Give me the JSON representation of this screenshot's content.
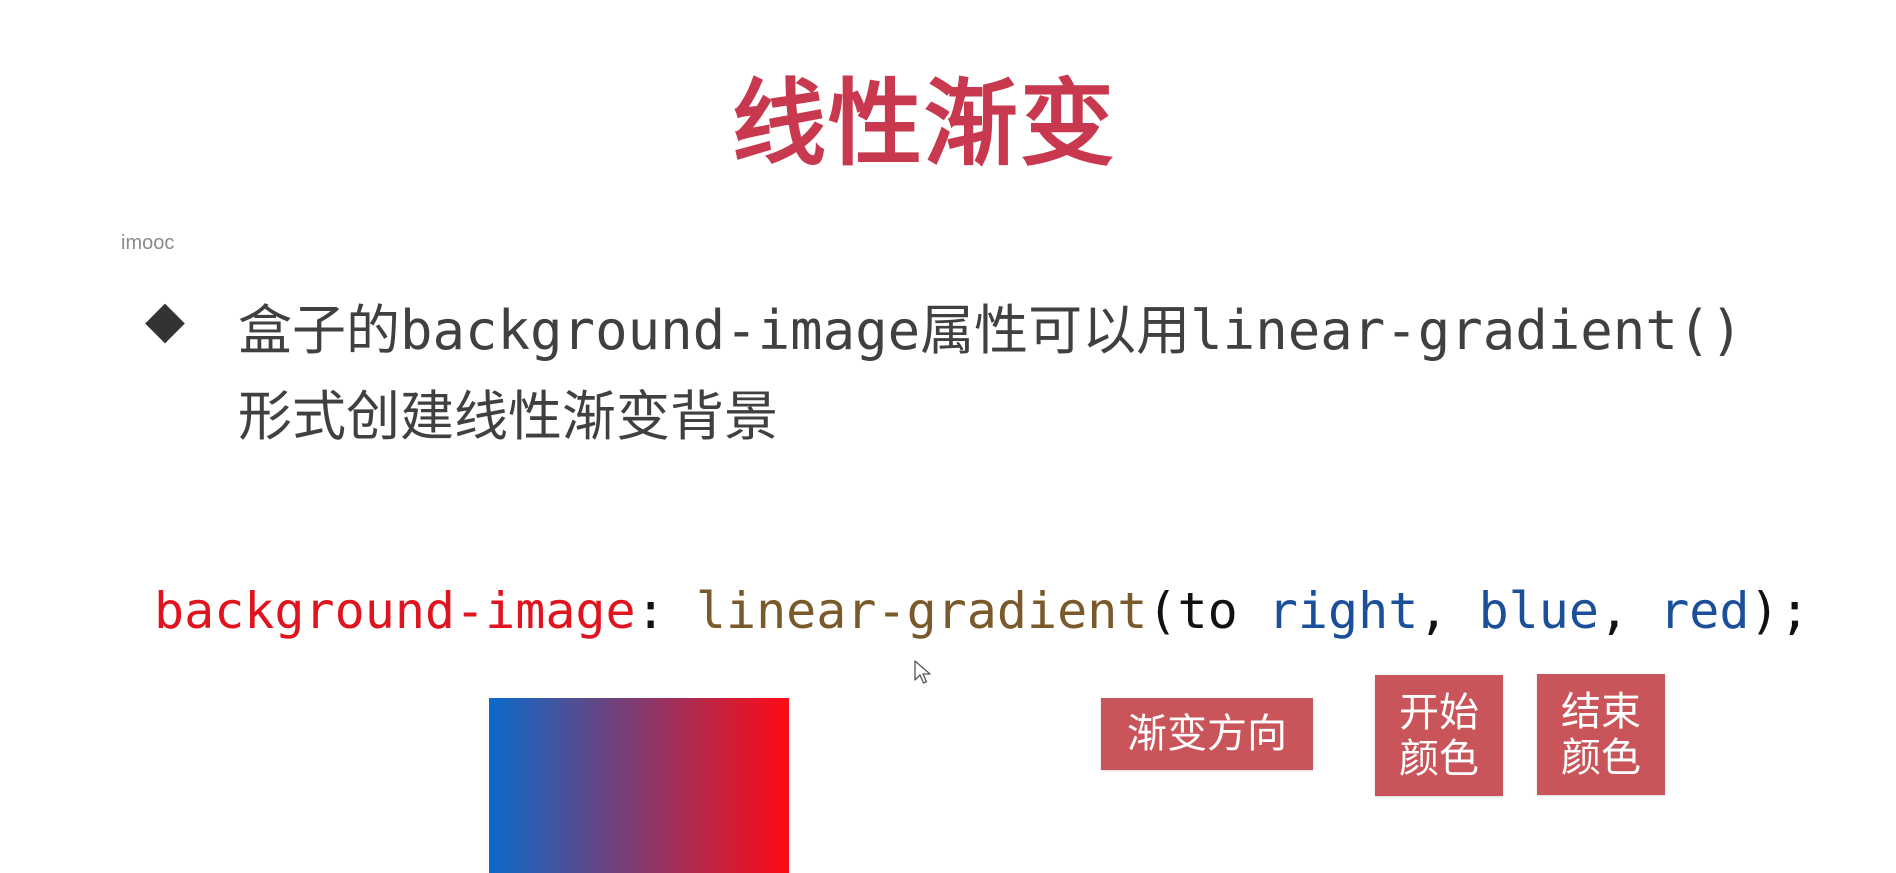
{
  "slide": {
    "title": "线性渐变",
    "watermark": "imooc",
    "bullet": {
      "icon": "diamond-bullet-icon",
      "text_part1": "盒子的",
      "text_code1": "background-image",
      "text_part2": "属性可以用",
      "text_code2": "linear-gradient()",
      "text_part3": "形式创建线性渐变背景"
    },
    "code": {
      "property": "background-image",
      "colon": ": ",
      "function": "linear-gradient",
      "open_paren": "(",
      "to": "to ",
      "direction": "right",
      "comma1": ", ",
      "start_color": "blue",
      "comma2": ", ",
      "end_color": "red",
      "close": ");"
    },
    "annotations": {
      "direction_label": "渐变方向",
      "start_label_line1": "开始",
      "start_label_line2": "颜色",
      "end_label_line1": "结束",
      "end_label_line2": "颜色"
    },
    "colors": {
      "title": "#c8384f",
      "tag_bg": "#c9555a",
      "gradient_start": "#0a6ac8",
      "gradient_end": "#ff0a14"
    }
  }
}
